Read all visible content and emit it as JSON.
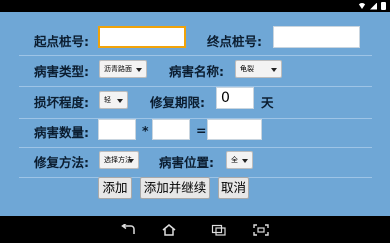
{
  "form": {
    "start_stake_label": "起点桩号:",
    "start_stake_value": "",
    "end_stake_label": "终点桩号:",
    "end_stake_value": "",
    "disease_type_label": "病害类型:",
    "disease_type_value": "沥青路面",
    "disease_name_label": "病害名称:",
    "disease_name_value": "龟裂",
    "damage_level_label": "损坏程度:",
    "damage_level_value": "轻",
    "repair_period_label": "修复期限:",
    "repair_period_value": "0",
    "repair_period_unit": "天",
    "quantity_label": "病害数量:",
    "quantity_a": "",
    "quantity_b": "",
    "quantity_result": "",
    "multiply_symbol": "*",
    "equals_symbol": "=",
    "repair_method_label": "修复方法:",
    "repair_method_value": "选择方法",
    "disease_position_label": "病害位置:",
    "disease_position_value": "全"
  },
  "buttons": {
    "add": "添加",
    "add_continue": "添加并继续",
    "cancel": "取消"
  },
  "colors": {
    "form_background": "#6fa7d6",
    "focus_border": "#f0a30a"
  },
  "icons": {
    "status": [
      "wifi-icon",
      "signal-icon",
      "battery-icon"
    ],
    "nav": [
      "back-icon",
      "home-icon",
      "recent-apps-icon",
      "screenshot-icon"
    ]
  }
}
